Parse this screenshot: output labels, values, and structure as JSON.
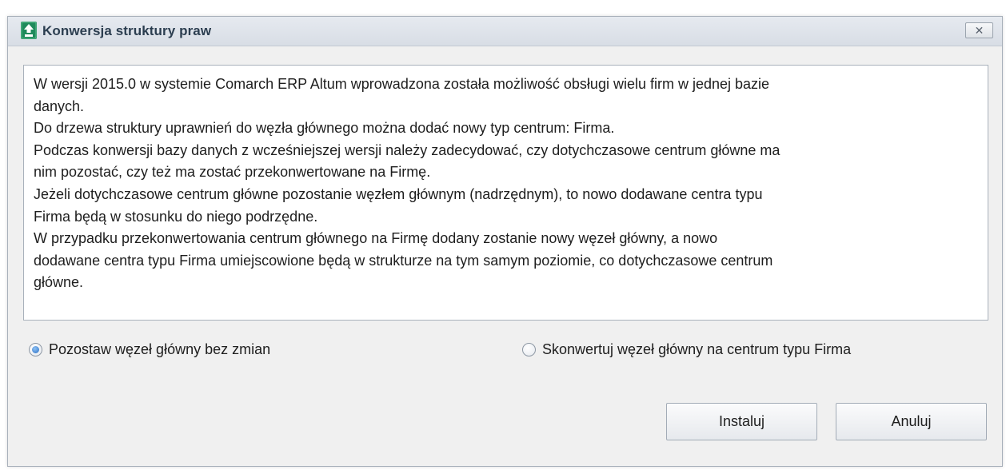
{
  "window": {
    "title": "Konwersja struktury praw",
    "close_label": "✕"
  },
  "message": {
    "lines": [
      "W wersji 2015.0 w systemie Comarch ERP Altum wprowadzona została możliwość obsługi wielu firm w jednej bazie",
      "danych.",
      "Do drzewa struktury uprawnień do węzła głównego można dodać nowy typ centrum: Firma.",
      "Podczas konwersji bazy danych z wcześniejszej wersji należy zadecydować, czy dotychczasowe centrum główne ma",
      "nim pozostać, czy też ma zostać przekonwertowane na Firmę.",
      "Jeżeli dotychczasowe centrum główne pozostanie węzłem głównym (nadrzędnym), to nowo dodawane centra typu",
      "Firma będą w stosunku do niego podrzędne.",
      "W przypadku przekonwertowania centrum głównego na Firmę dodany zostanie nowy węzeł główny, a nowo",
      "dodawane centra typu Firma umiejscowione będą w strukturze na tym samym poziomie, co dotychczasowe centrum",
      "główne."
    ]
  },
  "options": {
    "keep_label": "Pozostaw węzeł główny bez zmian",
    "keep_selected": true,
    "convert_label": "Skonwertuj węzeł główny na centrum typu Firma",
    "convert_selected": false
  },
  "buttons": {
    "install_label": "Instaluj",
    "cancel_label": "Anuluj"
  },
  "colors": {
    "icon_green": "#1f8a5b",
    "radio_selected": "#2a6fc4"
  }
}
